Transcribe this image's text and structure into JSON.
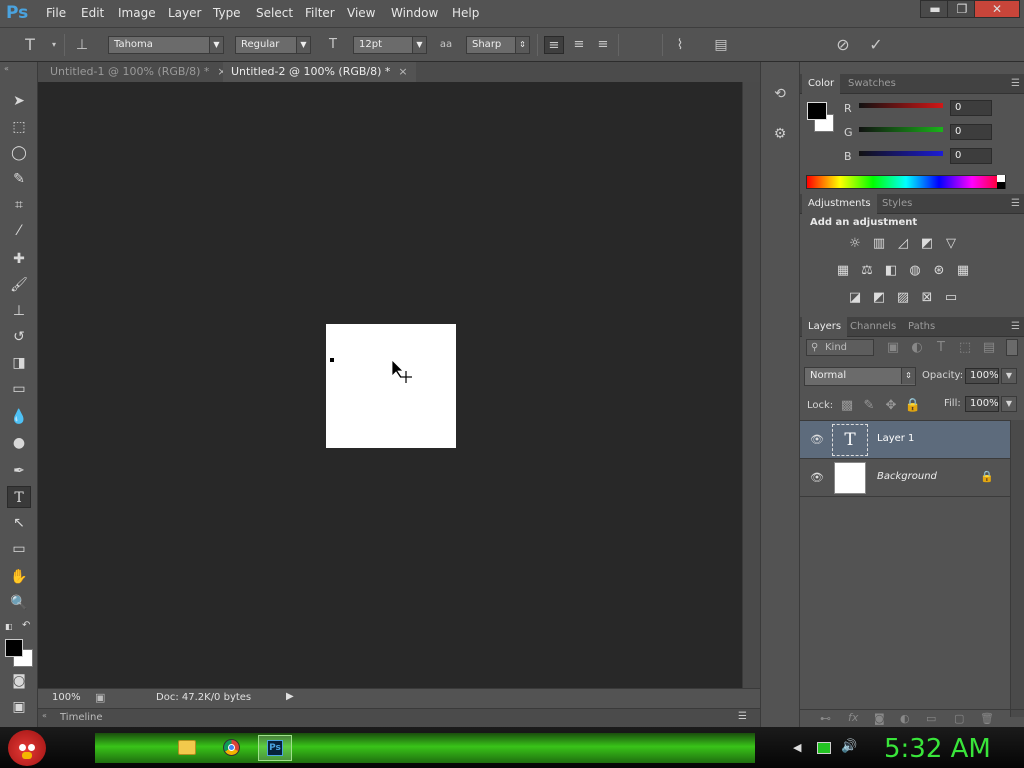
{
  "app": {
    "logo": "Ps"
  },
  "menu": [
    "File",
    "Edit",
    "Image",
    "Layer",
    "Type",
    "Select",
    "Filter",
    "View",
    "Window",
    "Help"
  ],
  "window_controls": {
    "minimize": "▬",
    "restore": "❐",
    "close": "✕"
  },
  "options": {
    "tool_glyph": "T",
    "font_family": "Tahoma",
    "font_style": "Regular",
    "font_size": "12pt",
    "antialias": "Sharp",
    "aa_glyph": "aa",
    "text_color": "#000000"
  },
  "tabs": [
    {
      "label": "Untitled-1 @ 100% (RGB/8) *",
      "close": "×"
    },
    {
      "label": "Untitled-2 @ 100% (RGB/8) *",
      "close": "×"
    }
  ],
  "status": {
    "zoom": "100%",
    "doc_info": "Doc: 47.2K/0 bytes"
  },
  "timeline": {
    "label": "Timeline"
  },
  "color_panel": {
    "tabs": [
      "Color",
      "Swatches"
    ],
    "channels": [
      {
        "label": "R",
        "value": "0",
        "color": "#d01818"
      },
      {
        "label": "G",
        "value": "0",
        "color": "#1ab31a"
      },
      {
        "label": "B",
        "value": "0",
        "color": "#1c1cd6"
      }
    ]
  },
  "adjustments_panel": {
    "tabs": [
      "Adjustments",
      "Styles"
    ],
    "title": "Add an adjustment"
  },
  "layers_panel": {
    "tabs": [
      "Layers",
      "Channels",
      "Paths"
    ],
    "filter_kind": "Kind",
    "blend_mode": "Normal",
    "opacity_label": "Opacity:",
    "opacity": "100%",
    "lock_label": "Lock:",
    "fill_label": "Fill:",
    "fill": "100%",
    "layers": [
      {
        "name": "Layer 1",
        "selected": true
      },
      {
        "name": "Background",
        "selected": false
      }
    ]
  },
  "taskbar": {
    "clock": "5:32 AM",
    "accent": "#39e53a"
  }
}
